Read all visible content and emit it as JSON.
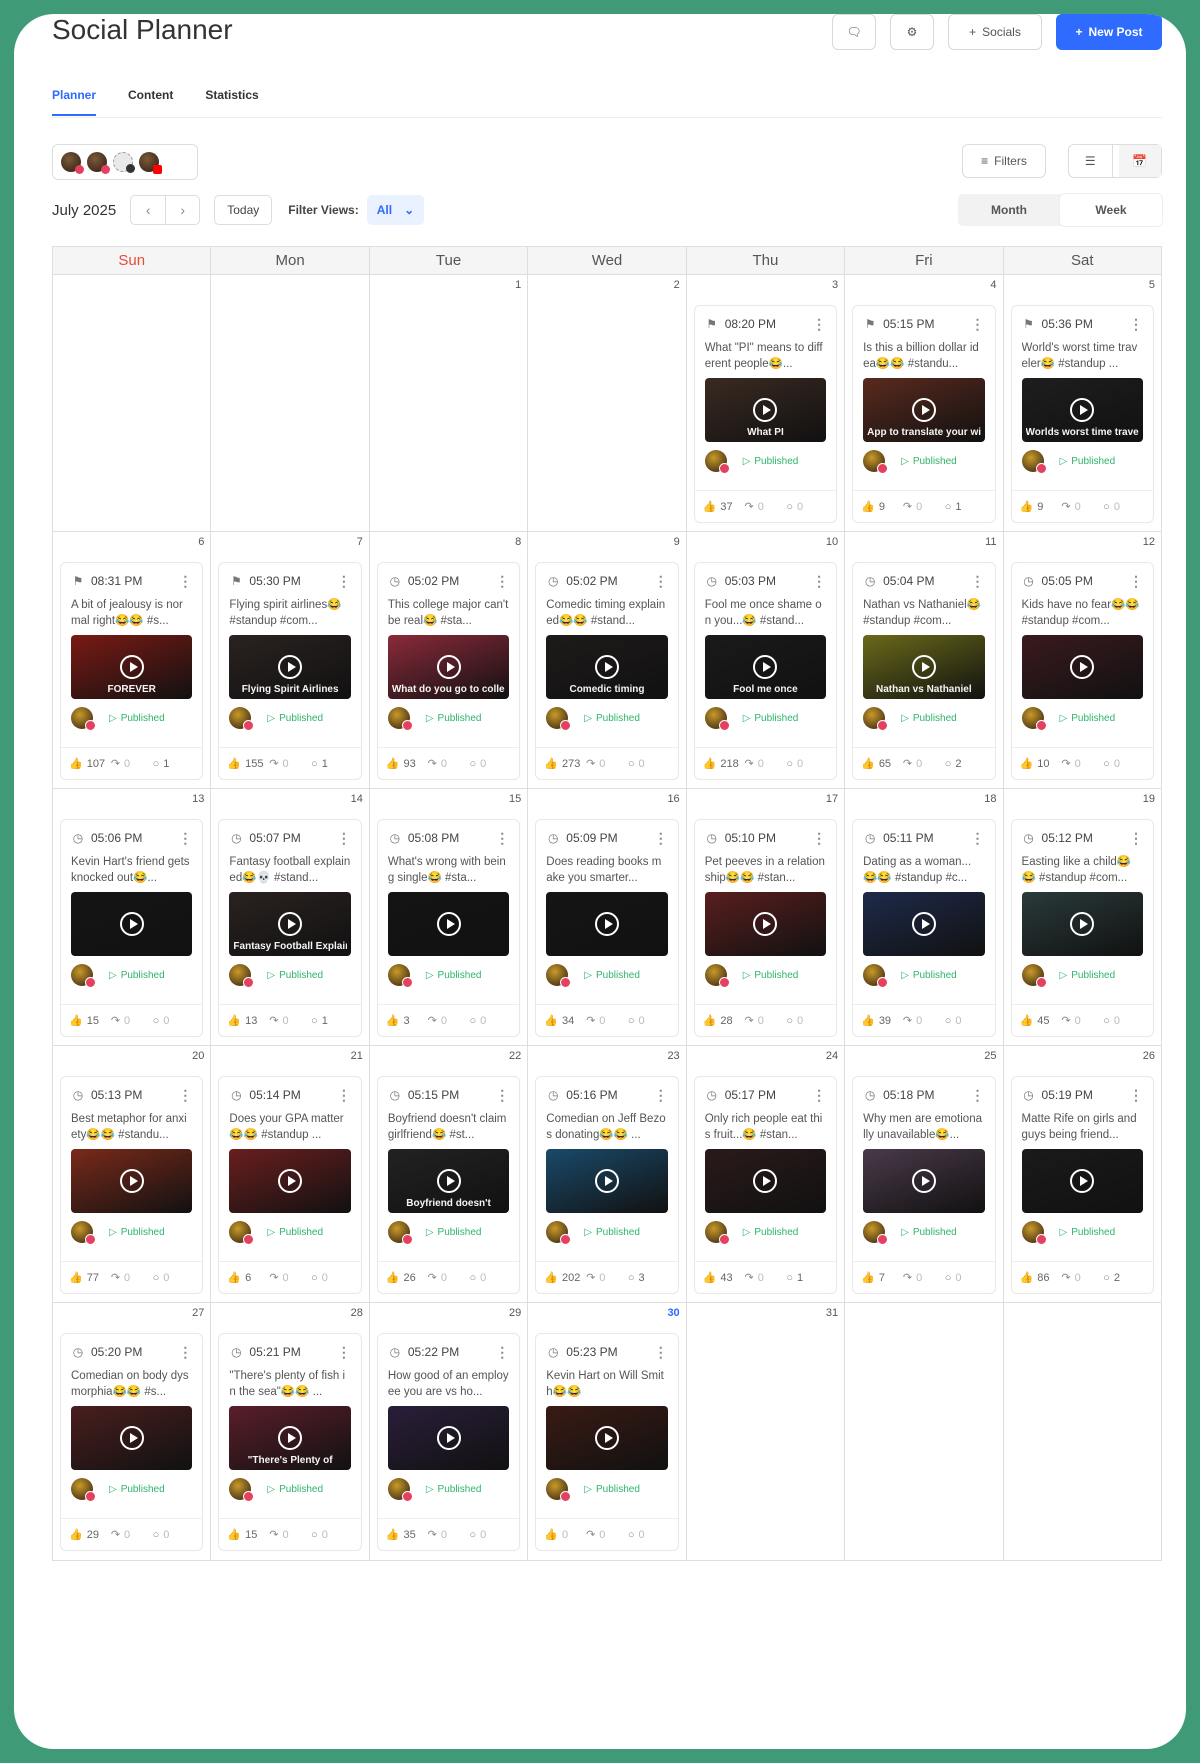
{
  "app": {
    "title": "Social Planner",
    "header_buttons": {
      "socials": "Socials",
      "new_post": "New Post"
    },
    "tabs": [
      "Planner",
      "Content",
      "Statistics"
    ],
    "active_tab": "Planner",
    "filters_label": "Filters",
    "month_label": "July 2025",
    "today_label": "Today",
    "filter_views_label": "Filter Views:",
    "filter_views_value": "All",
    "view_modes": [
      "Month",
      "Week"
    ],
    "active_view": "Week",
    "brand_color": "#2f6bff",
    "published_color": "#2fb46a"
  },
  "calendar": {
    "days_of_week": [
      "Sun",
      "Mon",
      "Tue",
      "Wed",
      "Thu",
      "Fri",
      "Sat"
    ],
    "today": "30",
    "status_label": "Published",
    "weeks": [
      [
        {
          "day": ""
        },
        {
          "day": ""
        },
        {
          "day": "1"
        },
        {
          "day": "2"
        },
        {
          "day": "3",
          "post": {
            "time": "08:20 PM",
            "caption": "What \"PI\" means to different people😂...",
            "thumb": "What PI",
            "likes": "37",
            "shares": "0",
            "comments": "0",
            "bg": "#3a2a22"
          }
        },
        {
          "day": "4",
          "post": {
            "time": "05:15 PM",
            "caption": "Is this a billion dollar idea😂😂 #standu...",
            "thumb": "App to translate your wife's texts AND I JUST WISH",
            "likes": "9",
            "shares": "0",
            "comments": "1",
            "bg": "#5a2a1e"
          }
        },
        {
          "day": "5",
          "post": {
            "time": "05:36 PM",
            "caption": "World's worst time traveler😂 #standup ...",
            "thumb": "Worlds worst time travel",
            "likes": "9",
            "shares": "0",
            "comments": "0",
            "bg": "#1e1e1e"
          }
        }
      ],
      [
        {
          "day": "6",
          "post": {
            "time": "08:31 PM",
            "caption": "A bit of jealousy is normal right😂😂 #s...",
            "thumb": "FOREVER",
            "likes": "107",
            "shares": "0",
            "comments": "1",
            "bg": "#7a1a14"
          }
        },
        {
          "day": "7",
          "post": {
            "time": "05:30 PM",
            "caption": "Flying spirit airlines😂 #standup #com...",
            "thumb": "Flying Spirit Airlines",
            "likes": "155",
            "shares": "0",
            "comments": "1",
            "bg": "#2a2220"
          }
        },
        {
          "day": "8",
          "post": {
            "time": "05:02 PM",
            "caption": "This college major can't be real😂 #sta...",
            "thumb": "What do you go to college for?",
            "likes": "93",
            "shares": "0",
            "comments": "0",
            "bg": "#8a2a3a"
          }
        },
        {
          "day": "9",
          "post": {
            "time": "05:02 PM",
            "caption": "Comedic timing explained😂😂 #stand...",
            "thumb": "Comedic timing",
            "likes": "273",
            "shares": "0",
            "comments": "0",
            "bg": "#1e1a1a"
          }
        },
        {
          "day": "10",
          "post": {
            "time": "05:03 PM",
            "caption": "Fool me once shame on you...😂 #stand...",
            "thumb": "Fool me once",
            "likes": "218",
            "shares": "0",
            "comments": "0",
            "bg": "#1a1a1a"
          }
        },
        {
          "day": "11",
          "post": {
            "time": "05:04 PM",
            "caption": "Nathan vs Nathaniel😂 #standup #com...",
            "thumb": "Nathan vs Nathaniel",
            "likes": "65",
            "shares": "0",
            "comments": "2",
            "bg": "#6a6a1a"
          }
        },
        {
          "day": "12",
          "post": {
            "time": "05:05 PM",
            "caption": "Kids have no fear😂😂 #standup #com...",
            "thumb": "",
            "likes": "10",
            "shares": "0",
            "comments": "0",
            "bg": "#3a1a1e"
          }
        }
      ],
      [
        {
          "day": "13",
          "post": {
            "time": "05:06 PM",
            "caption": "Kevin Hart's friend gets knocked out😂...",
            "thumb": "",
            "likes": "15",
            "shares": "0",
            "comments": "0",
            "bg": "#151515"
          }
        },
        {
          "day": "14",
          "post": {
            "time": "05:07 PM",
            "caption": "Fantasy football explained😂💀 #stand...",
            "thumb": "Fantasy Football Explained",
            "likes": "13",
            "shares": "0",
            "comments": "1",
            "bg": "#2a2220"
          }
        },
        {
          "day": "15",
          "post": {
            "time": "05:08 PM",
            "caption": "What's wrong with being single😂 #sta...",
            "thumb": "",
            "likes": "3",
            "shares": "0",
            "comments": "0",
            "bg": "#141414"
          }
        },
        {
          "day": "16",
          "post": {
            "time": "05:09 PM",
            "caption": "Does reading books make you smarter...",
            "thumb": "",
            "likes": "34",
            "shares": "0",
            "comments": "0",
            "bg": "#151515"
          }
        },
        {
          "day": "17",
          "post": {
            "time": "05:10 PM",
            "caption": "Pet peeves in a relationship😂😂 #stan...",
            "thumb": "",
            "likes": "28",
            "shares": "0",
            "comments": "0",
            "bg": "#5a1e1e"
          }
        },
        {
          "day": "18",
          "post": {
            "time": "05:11 PM",
            "caption": "Dating as a woman...😂😂 #standup #c...",
            "thumb": "",
            "likes": "39",
            "shares": "0",
            "comments": "0",
            "bg": "#1e2a4a"
          }
        },
        {
          "day": "19",
          "post": {
            "time": "05:12 PM",
            "caption": "Easting like a child😂😂 #standup #com...",
            "thumb": "",
            "likes": "45",
            "shares": "0",
            "comments": "0",
            "bg": "#2a3a3a"
          }
        }
      ],
      [
        {
          "day": "20",
          "post": {
            "time": "05:13 PM",
            "caption": "Best metaphor for anxiety😂😂 #standu...",
            "thumb": "",
            "likes": "77",
            "shares": "0",
            "comments": "0",
            "bg": "#7a2a1a"
          }
        },
        {
          "day": "21",
          "post": {
            "time": "05:14 PM",
            "caption": "Does your GPA matter😂😂 #standup ...",
            "thumb": "",
            "likes": "6",
            "shares": "0",
            "comments": "0",
            "bg": "#6a1e1e"
          }
        },
        {
          "day": "22",
          "post": {
            "time": "05:15 PM",
            "caption": "Boyfriend doesn't claim girlfriend😂 #st...",
            "thumb": "Boyfriend doesn't",
            "likes": "26",
            "shares": "0",
            "comments": "0",
            "bg": "#222"
          }
        },
        {
          "day": "23",
          "post": {
            "time": "05:16 PM",
            "caption": "Comedian on Jeff Bezos donating😂😂 ...",
            "thumb": "",
            "likes": "202",
            "shares": "0",
            "comments": "3",
            "bg": "#1a4a6a"
          }
        },
        {
          "day": "24",
          "post": {
            "time": "05:17 PM",
            "caption": "Only rich people eat this fruit...😂 #stan...",
            "thumb": "",
            "likes": "43",
            "shares": "0",
            "comments": "1",
            "bg": "#2a1a1a"
          }
        },
        {
          "day": "25",
          "post": {
            "time": "05:18 PM",
            "caption": "Why men are emotionally unavailable😂...",
            "thumb": "",
            "likes": "7",
            "shares": "0",
            "comments": "0",
            "bg": "#4a3a4a"
          }
        },
        {
          "day": "26",
          "post": {
            "time": "05:19 PM",
            "caption": "Matte Rife on girls and guys being friend...",
            "thumb": "",
            "likes": "86",
            "shares": "0",
            "comments": "2",
            "bg": "#1a1a1a"
          }
        }
      ],
      [
        {
          "day": "27",
          "post": {
            "time": "05:20 PM",
            "caption": "Comedian on body dysmorphia😂😂 #s...",
            "thumb": "",
            "likes": "29",
            "shares": "0",
            "comments": "0",
            "bg": "#4a1e1e"
          }
        },
        {
          "day": "28",
          "post": {
            "time": "05:21 PM",
            "caption": "\"There's plenty of fish in the sea\"😂😂 ...",
            "thumb": "\"There's Plenty of",
            "likes": "15",
            "shares": "0",
            "comments": "0",
            "bg": "#5a1e2a"
          }
        },
        {
          "day": "29",
          "post": {
            "time": "05:22 PM",
            "caption": "How good of an employee you are vs ho...",
            "thumb": "",
            "likes": "35",
            "shares": "0",
            "comments": "0",
            "bg": "#2a1e3a"
          }
        },
        {
          "day": "30",
          "post": {
            "time": "05:23 PM",
            "caption": "Kevin Hart on Will Smith😂😂",
            "thumb": "",
            "likes": "0",
            "shares": "0",
            "comments": "0",
            "bg": "#3a1a14"
          }
        },
        {
          "day": "31"
        },
        {
          "day": ""
        },
        {
          "day": ""
        }
      ]
    ]
  }
}
